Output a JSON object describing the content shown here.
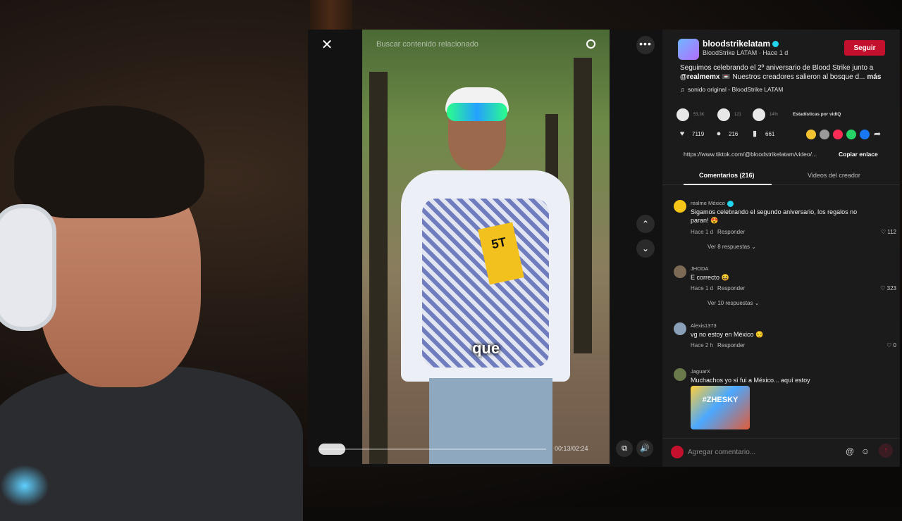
{
  "modal": {
    "close_icon": "close-icon",
    "search_placeholder": "Buscar contenido relacionado",
    "caption": "que",
    "time": "00:13/02:24",
    "progress": 0.09,
    "box_text": "5T"
  },
  "author": {
    "name": "bloodstrikelatam",
    "sub": "BloodStrike LATAM · Hace 1 d",
    "follow": "Seguir",
    "desc_lead": "Seguimos celebrando el 2º aniversario de Blood Strike junto a",
    "desc_mention": "@realmemx",
    "desc_rest": "📼 Nuestros creadores salieron al bosque d...",
    "desc_more": "más",
    "sound": "sonido original - BloodStrike LATAM"
  },
  "stats": {
    "v1": "53,3K",
    "v2": "121",
    "v3": "14%",
    "label": "Estadísticas por vidIQ"
  },
  "actions": {
    "likes": "7119",
    "comments": "216",
    "saves": "661",
    "share_colors": [
      "#f2c230",
      "#9a9a9a",
      "#fe2c55",
      "#25d366",
      "#1877f2"
    ]
  },
  "link": {
    "url": "https://www.tiktok.com/@bloodstrikelatam/video/...",
    "copy": "Copiar enlace"
  },
  "tabs": {
    "comments": "Comentarios (216)",
    "creator_videos": "Videos del creador"
  },
  "comments": [
    {
      "user": "realme México",
      "text": "Sigamos celebrando el segundo aniversario, los regalos no paran! 😍",
      "time": "Hace 1 d",
      "reply": "Responder",
      "likes": "112",
      "more": "Ver 8 respuestas ⌄",
      "avatar_color": "#f5c518"
    },
    {
      "user": "JHODA",
      "text": "E correcto 😆",
      "time": "Hace 1 d",
      "reply": "Responder",
      "likes": "323",
      "more": "Ver 10 respuestas ⌄",
      "avatar_color": "#7d6a55"
    },
    {
      "user": "Alexis1373",
      "text": "vg no estoy en México 😔",
      "time": "Hace 2 h",
      "reply": "Responder",
      "likes": "0",
      "avatar_color": "#8aa0b8"
    },
    {
      "user": "JaguarX",
      "text": "Muchachos yo sí fui a México... aquí estoy",
      "sticker": "#ZHESKY",
      "avatar_color": "#6b7a4a"
    }
  ],
  "composer": {
    "placeholder": "Agregar comentario...",
    "at_icon": "@",
    "emoji_icon": "☺"
  }
}
